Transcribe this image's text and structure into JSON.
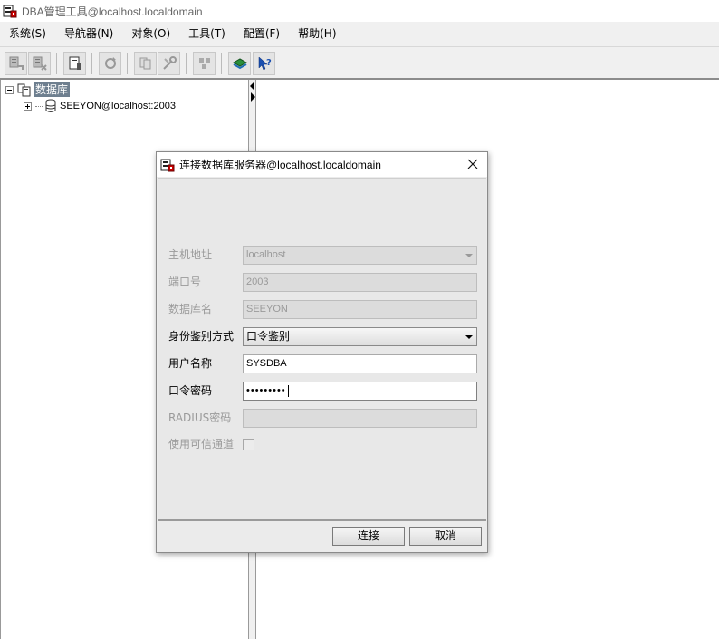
{
  "window": {
    "title": "DBA管理工具@localhost.localdomain"
  },
  "menubar": {
    "items": [
      {
        "label": "系统(S)"
      },
      {
        "label": "导航器(N)"
      },
      {
        "label": "对象(O)"
      },
      {
        "label": "工具(T)"
      },
      {
        "label": "配置(F)"
      },
      {
        "label": "帮助(H)"
      }
    ]
  },
  "tree": {
    "root_label": "数据库",
    "nodes": [
      {
        "label": "SEEYON@localhost:2003"
      }
    ]
  },
  "dialog": {
    "title": "连接数据库服务器@localhost.localdomain",
    "fields": {
      "host": {
        "label": "主机地址",
        "value": "localhost"
      },
      "port": {
        "label": "端口号",
        "value": "2003"
      },
      "dbname": {
        "label": "数据库名",
        "value": "SEEYON"
      },
      "auth": {
        "label": "身份鉴别方式",
        "value": "口令鉴别"
      },
      "username": {
        "label": "用户名称",
        "value": "SYSDBA"
      },
      "password": {
        "label": "口令密码",
        "value": "•••••••••"
      },
      "radius": {
        "label": "RADIUS密码",
        "value": ""
      },
      "trusted": {
        "label": "使用可信通道"
      }
    },
    "buttons": {
      "connect": "连接",
      "cancel": "取消"
    }
  },
  "colors": {
    "tree_selection": "#6e7f8f",
    "toolbar_bg": "#f0f0f0",
    "dialog_bg": "#e8e8e8",
    "disabled_text": "#9a9a9a"
  }
}
